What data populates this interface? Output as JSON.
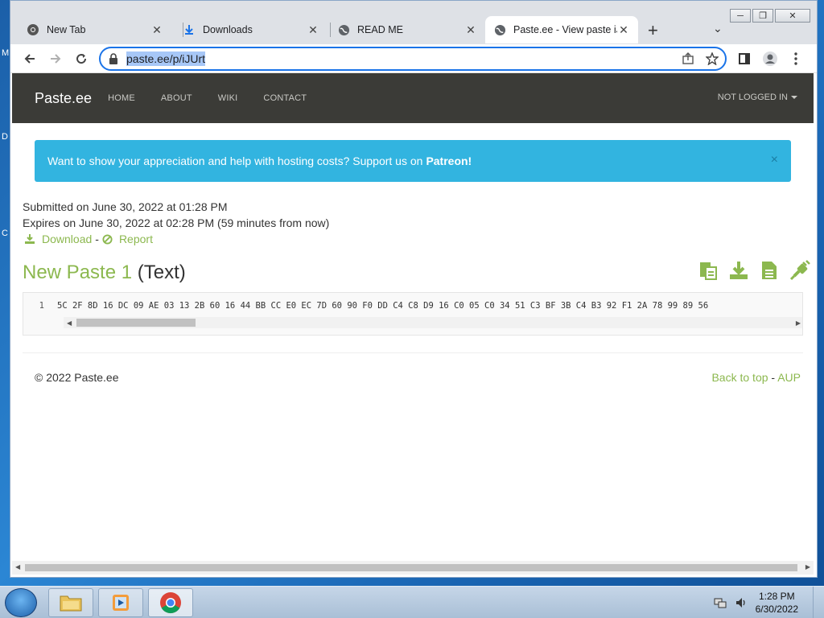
{
  "desktop": {
    "glimpses": [
      "M",
      "D",
      "C"
    ]
  },
  "browser": {
    "tabs": [
      {
        "title": "New Tab",
        "icon": "chrome-icon",
        "active": false
      },
      {
        "title": "Downloads",
        "icon": "download-icon",
        "active": false
      },
      {
        "title": "READ ME",
        "icon": "globe-icon",
        "active": false
      },
      {
        "title": "Paste.ee - View paste iJU",
        "icon": "globe-icon",
        "active": true
      }
    ],
    "new_tab": "+",
    "url": "paste.ee/p/iJUrt"
  },
  "site": {
    "brand": "Paste.ee",
    "nav": [
      "HOME",
      "ABOUT",
      "WIKI",
      "CONTACT"
    ],
    "user_menu": "NOT LOGGED IN",
    "alert": {
      "text": "Want to show your appreciation and help with hosting costs? Support us on",
      "link": "Patreon!",
      "close": "×"
    },
    "meta": {
      "submitted": "Submitted on June 30, 2022 at 01:28 PM",
      "expires": "Expires on June 30, 2022 at 02:28 PM (59 minutes from now)",
      "download": "Download",
      "separator": "-",
      "report": "Report"
    },
    "paste": {
      "name": "New Paste 1",
      "type": "(Text)",
      "line_number": "1",
      "content": "5C 2F 8D 16 DC 09 AE 03 13 2B 60 16 44 BB CC E0 EC 7D 60 90 F0 DD C4 C8 D9 16 C0 05 C0 34 51 C3 BF 3B C4 B3 92 F1 2A 78 99 89 56"
    },
    "footer": {
      "copyright": "© 2022 Paste.ee",
      "back_to_top": "Back to top",
      "separator": "-",
      "aup": "AUP"
    }
  },
  "taskbar": {
    "time": "1:28 PM",
    "date": "6/30/2022"
  },
  "colors": {
    "accent_green": "#8cb84f",
    "alert_blue": "#32b4e0",
    "navbar": "#3b3b37",
    "focus_blue": "#1a73e8"
  }
}
